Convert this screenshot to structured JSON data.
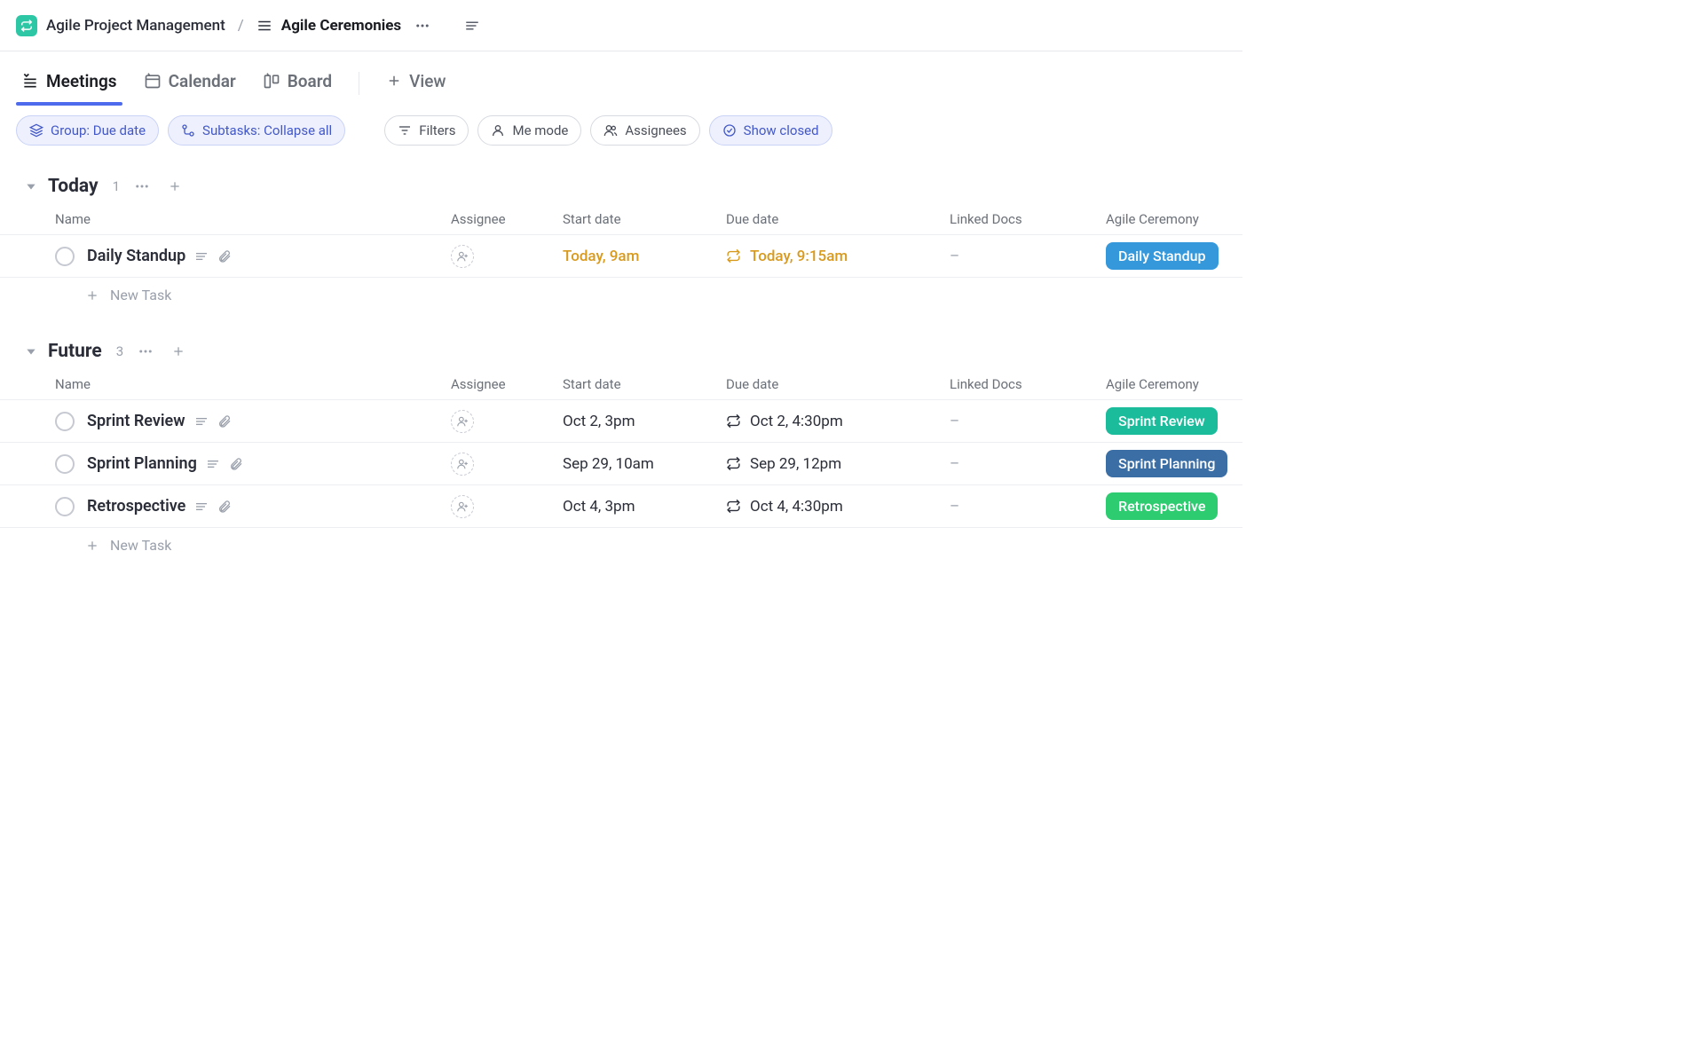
{
  "header": {
    "space_name": "Agile Project Management",
    "separator": "/",
    "list_name": "Agile Ceremonies"
  },
  "tabs": {
    "meetings": "Meetings",
    "calendar": "Calendar",
    "board": "Board",
    "add_view": "View"
  },
  "filters": {
    "group": "Group: Due date",
    "subtasks": "Subtasks: Collapse all",
    "filters": "Filters",
    "me_mode": "Me mode",
    "assignees": "Assignees",
    "show_closed": "Show closed"
  },
  "columns": {
    "name": "Name",
    "assignee": "Assignee",
    "start": "Start date",
    "due": "Due date",
    "linked": "Linked Docs",
    "ceremony": "Agile Ceremony"
  },
  "groups": {
    "today": {
      "title": "Today",
      "count": "1",
      "new_task": "New Task"
    },
    "future": {
      "title": "Future",
      "count": "3",
      "new_task": "New Task"
    }
  },
  "tasks": {
    "today": [
      {
        "name": "Daily Standup",
        "start": "Today, 9am",
        "due": "Today, 9:15am",
        "linked": "–",
        "ceremony": "Daily Standup",
        "warn": true,
        "tagClass": "tag-blue"
      }
    ],
    "future": [
      {
        "name": "Sprint Review",
        "start": "Oct 2, 3pm",
        "due": "Oct 2, 4:30pm",
        "linked": "–",
        "ceremony": "Sprint Review",
        "tagClass": "tag-teal"
      },
      {
        "name": "Sprint Planning",
        "start": "Sep 29, 10am",
        "due": "Sep 29, 12pm",
        "linked": "–",
        "ceremony": "Sprint Planning",
        "tagClass": "tag-steel"
      },
      {
        "name": "Retrospective",
        "start": "Oct 4, 3pm",
        "due": "Oct 4, 4:30pm",
        "linked": "–",
        "ceremony": "Retrospective",
        "tagClass": "tag-green"
      }
    ]
  }
}
